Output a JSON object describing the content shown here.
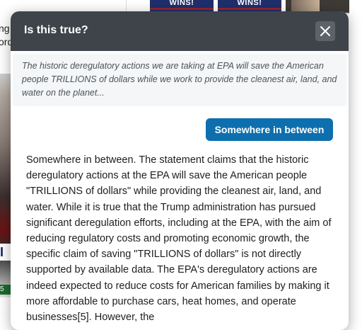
{
  "background": {
    "fragment_line_1": "ng",
    "fragment_line_2": "ord",
    "thumb_a_text": "WINS!",
    "thumb_b_text": "WINS!",
    "chyron_text": "I D",
    "badge_text": "5",
    "colors": {
      "thumb_navy": "#1f2f6b",
      "thumb_red": "#b51f1f"
    }
  },
  "modal": {
    "title": "Is this true?",
    "close_icon": "close-icon",
    "quote": "The historic deregulatory actions we are taking at EPA will save the American people TRILLIONS of dollars while we work to provide the cleanest air, land, and water on the planet...",
    "verdict_label": "Somewhere in between",
    "answer": "Somewhere in between. The statement claims that the historic deregulatory actions at the EPA will save the American people \"TRILLIONS of dollars\" while providing the cleanest air, land, and water. While it is true that the Trump administration has pursued significant deregulation efforts, including at the EPA, with the aim of reducing regulatory costs and promoting economic growth, the specific claim of saving \"TRILLIONS of dollars\" is not directly supported by available data. The EPA's deregulatory actions are indeed expected to reduce costs for American families by making it more affordable to purchase cars, heat homes, and operate businesses[5]. However, the",
    "colors": {
      "header_bg": "#3e4449",
      "close_bg": "#5b6268",
      "quote_bg": "#f4f6f8",
      "verdict_bg": "#0e6fae"
    }
  }
}
